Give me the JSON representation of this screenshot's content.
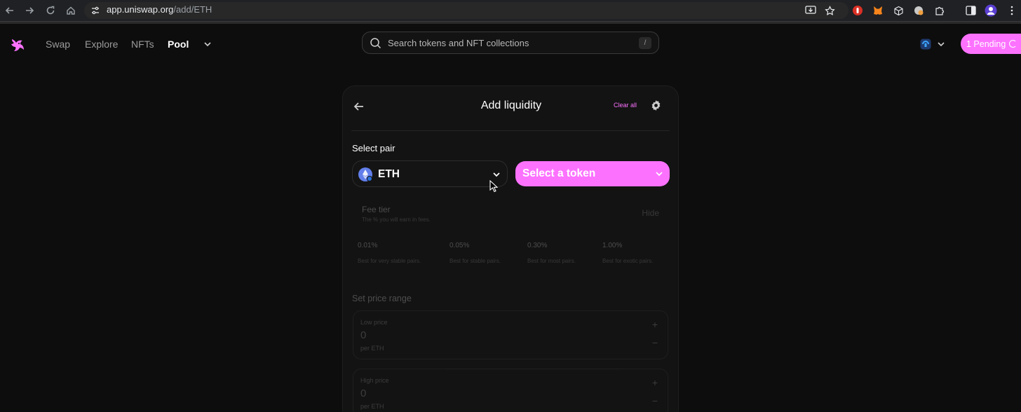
{
  "browser": {
    "url_host": "app.uniswap.org",
    "url_path": "/add/ETH"
  },
  "nav": {
    "links": [
      "Swap",
      "Explore",
      "NFTs",
      "Pool"
    ],
    "search_placeholder": "Search tokens and NFT collections",
    "search_shortcut": "/",
    "pending_label": "1 Pending"
  },
  "card": {
    "title": "Add liquidity",
    "clear_all": "Clear all",
    "select_pair_label": "Select pair",
    "token_a": "ETH",
    "token_b_placeholder": "Select a token",
    "fee": {
      "title": "Fee tier",
      "subtitle": "The % you will earn in fees.",
      "hide": "Hide"
    },
    "tiers": [
      {
        "pct": "0.01%",
        "desc": "Best for very stable pairs."
      },
      {
        "pct": "0.05%",
        "desc": "Best for stable pairs."
      },
      {
        "pct": "0.30%",
        "desc": "Best for most pairs."
      },
      {
        "pct": "1.00%",
        "desc": "Best for exotic pairs."
      }
    ],
    "range_label": "Set price range",
    "low": {
      "label": "Low price",
      "value": "0",
      "unit": "per ETH"
    },
    "high": {
      "label": "High price",
      "value": "0",
      "unit": "per ETH"
    },
    "plus": "+",
    "minus": "−"
  },
  "colors": {
    "accent_pink": "#fc72ff",
    "background": "#0d0d0d",
    "card": "#131313"
  }
}
